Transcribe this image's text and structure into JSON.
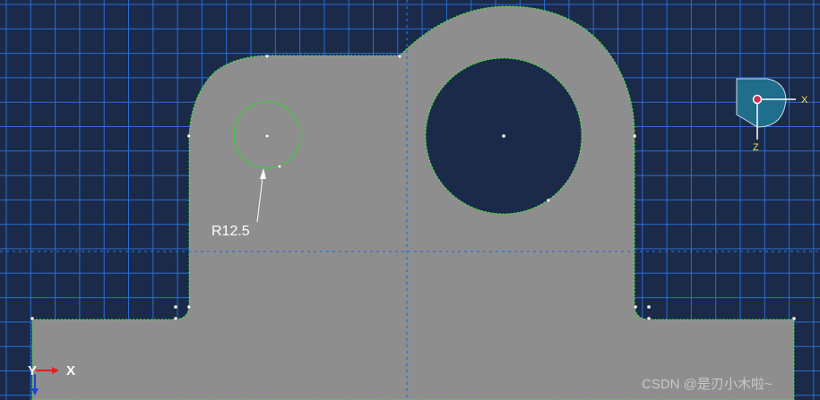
{
  "sketch": {
    "dimension_label": "R12.5",
    "colors": {
      "background": "#1b2a48",
      "grid": "#2a6fd6",
      "part_fill": "#8e8e8e",
      "edge": "#2aff2a",
      "circle": "#2bd62b",
      "vertex": "#ffffff",
      "dimension_text": "#ffffff"
    }
  },
  "orientation_triad": {
    "x_label": "X",
    "z_label": "Z",
    "color": "#1e6e8c"
  },
  "axis_triad": {
    "y_label": "Y",
    "x_label": "X"
  },
  "watermark": "CSDN @是刃小木啦~"
}
